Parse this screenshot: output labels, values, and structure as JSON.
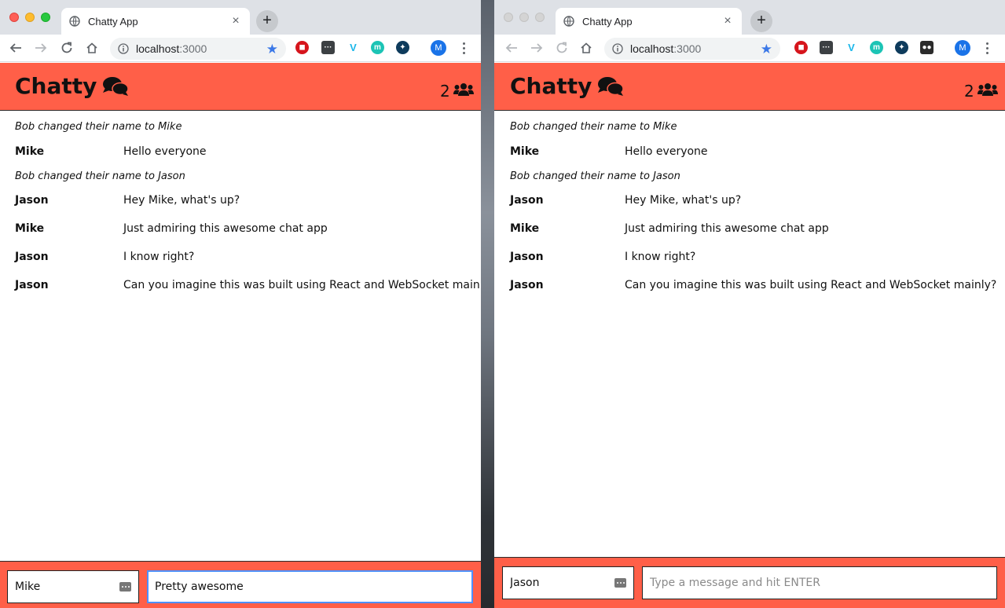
{
  "windows": [
    {
      "id": "left",
      "tab_title": "Chatty App",
      "url_host": "localhost",
      "url_port": ":3000",
      "app": {
        "brand": "Chatty",
        "user_count": "2",
        "messages": [
          {
            "type": "system",
            "text": "Bob changed their name to Mike"
          },
          {
            "type": "user",
            "user": "Mike",
            "text": "Hello everyone"
          },
          {
            "type": "system",
            "text": "Bob changed their name to Jason"
          },
          {
            "type": "user",
            "user": "Jason",
            "text": "Hey Mike, what's up?"
          },
          {
            "type": "user",
            "user": "Mike",
            "text": "Just admiring this awesome chat app"
          },
          {
            "type": "user",
            "user": "Jason",
            "text": "I know right?"
          },
          {
            "type": "user",
            "user": "Jason",
            "text": "Can you imagine this was built using React and WebSocket mainly?"
          }
        ],
        "username_value": "Mike",
        "message_value": "Pretty awesome",
        "message_placeholder": "Type a message and hit ENTER"
      }
    },
    {
      "id": "right",
      "tab_title": "Chatty App",
      "url_host": "localhost",
      "url_port": ":3000",
      "app": {
        "brand": "Chatty",
        "user_count": "2",
        "messages": [
          {
            "type": "system",
            "text": "Bob changed their name to Mike"
          },
          {
            "type": "user",
            "user": "Mike",
            "text": "Hello everyone"
          },
          {
            "type": "system",
            "text": "Bob changed their name to Jason"
          },
          {
            "type": "user",
            "user": "Jason",
            "text": "Hey Mike, what's up?"
          },
          {
            "type": "user",
            "user": "Mike",
            "text": "Just admiring this awesome chat app"
          },
          {
            "type": "user",
            "user": "Jason",
            "text": "I know right?"
          },
          {
            "type": "user",
            "user": "Jason",
            "text": "Can you imagine this was built using React and WebSocket mainly?"
          }
        ],
        "username_value": "Jason",
        "message_value": "",
        "message_placeholder": "Type a message and hit ENTER"
      }
    }
  ],
  "extensions_left": [
    "ublock-icon",
    "window-icon",
    "vimeo-icon",
    "momentum-icon",
    "dashlane-icon"
  ],
  "extensions_right": [
    "ublock-icon",
    "window-icon",
    "vimeo-icon",
    "momentum-icon",
    "dashlane-icon",
    "incognito-icon"
  ],
  "profile_initial": "M",
  "colors": {
    "navbar": "#ff5f48",
    "focus_ring": "#4d90fe",
    "star": "#3b78e7"
  },
  "icons": {
    "brand": "comments-icon",
    "users": "users-icon",
    "autofill": "autofill-key-icon"
  }
}
